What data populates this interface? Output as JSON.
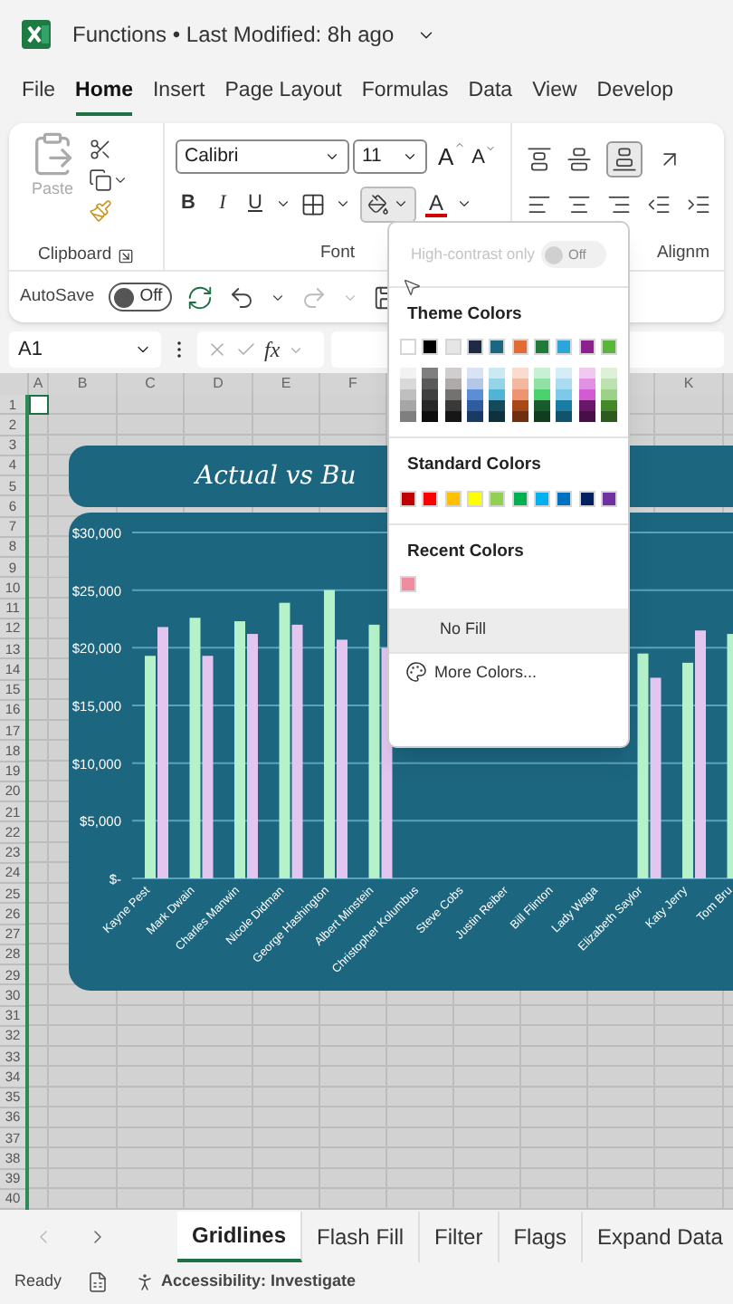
{
  "title_bar": {
    "document": "Functions • Last Modified: 8h ago"
  },
  "menu_tabs": [
    {
      "label": "File",
      "selected": false
    },
    {
      "label": "Home",
      "selected": true
    },
    {
      "label": "Insert",
      "selected": false
    },
    {
      "label": "Page Layout",
      "selected": false
    },
    {
      "label": "Formulas",
      "selected": false
    },
    {
      "label": "Data",
      "selected": false
    },
    {
      "label": "View",
      "selected": false
    },
    {
      "label": "Develop",
      "selected": false
    }
  ],
  "ribbon": {
    "clipboard": {
      "paste": "Paste",
      "label": "Clipboard",
      "paste_disabled": true
    },
    "font": {
      "name": "Calibri",
      "size": "11",
      "grow": "A",
      "shrink": "A",
      "bold": "B",
      "italic": "I",
      "underline": "U",
      "font_color": "A",
      "fill_pressed": true,
      "label": "Font"
    },
    "alignment": {
      "label": "Alignm",
      "bottom_align_pressed": true
    }
  },
  "quick_access": {
    "autosave": "AutoSave",
    "autosave_on": false,
    "toggle_text": "Off",
    "redo_disabled": true
  },
  "formula_bar": {
    "name_box": "A1",
    "fx": "fx"
  },
  "columns": [
    "A",
    "B",
    "C",
    "D",
    "E",
    "F",
    "K"
  ],
  "rows": [
    "1",
    "2",
    "3",
    "4",
    "5",
    "6",
    "7",
    "8",
    "9",
    "10",
    "11",
    "12",
    "13",
    "14",
    "15",
    "16",
    "17",
    "18",
    "19",
    "20",
    "21",
    "22",
    "23",
    "24",
    "25",
    "26",
    "27",
    "28",
    "29",
    "30",
    "31",
    "32",
    "33",
    "34",
    "35",
    "36",
    "37",
    "38",
    "39",
    "40"
  ],
  "chart": {
    "title": "Actual vs Bu",
    "chart_data": {
      "type": "bar",
      "categories": [
        "Kayne Pest",
        "Mark Dwain",
        "Charles Manwin",
        "Nicole Didman",
        "George Hashington",
        "Albert Minstein",
        "Christopher Kolumbus",
        "Steve Cobs",
        "Justin Reiber",
        "Bill Flinton",
        "Lady Waga",
        "Elizabeth Saylor",
        "Katy Jerry",
        "Tom Bru"
      ],
      "series": [
        {
          "color": "#b6f2c9",
          "values": [
            19300,
            22600,
            22300,
            23900,
            25000,
            22000,
            null,
            null,
            null,
            null,
            null,
            19500,
            18700,
            21200
          ]
        },
        {
          "color": "#e2c6f0",
          "values": [
            21800,
            19300,
            21200,
            22000,
            20700,
            20000,
            null,
            null,
            null,
            null,
            null,
            17400,
            21500,
            null
          ]
        }
      ],
      "grid": true,
      "ylim": [
        0,
        30000
      ],
      "yticks": [
        {
          "value": 0,
          "label": "$-"
        },
        {
          "value": 5000,
          "label": "$5,000"
        },
        {
          "value": 10000,
          "label": "$10,000"
        },
        {
          "value": 15000,
          "label": "$15,000"
        },
        {
          "value": 20000,
          "label": "$20,000"
        },
        {
          "value": 25000,
          "label": "$25,000"
        },
        {
          "value": 30000,
          "label": "$30,000"
        }
      ]
    }
  },
  "color_menu": {
    "high_contrast": {
      "label": "High-contrast only",
      "on": false,
      "disabled": true,
      "toggle_text": "Off"
    },
    "theme_title": "Theme Colors",
    "theme_colors": [
      {
        "color": "#ffffff",
        "shades": [
          {
            "color": "#f2f2f2"
          },
          {
            "color": "#d9d9d9"
          },
          {
            "color": "#bfbfbf"
          },
          {
            "color": "#a6a6a6"
          },
          {
            "color": "#7f7f7f"
          }
        ]
      },
      {
        "color": "#000000",
        "shades": [
          {
            "color": "#7f7f7f"
          },
          {
            "color": "#595959"
          },
          {
            "color": "#3f3f3f"
          },
          {
            "color": "#262626"
          },
          {
            "color": "#0d0d0d"
          }
        ]
      },
      {
        "color": "#e7e6e6",
        "shades": [
          {
            "color": "#d0cece"
          },
          {
            "color": "#aeaaaa"
          },
          {
            "color": "#757171"
          },
          {
            "color": "#3a3838"
          },
          {
            "color": "#171616"
          }
        ]
      },
      {
        "color": "#1f2a44",
        "shades": [
          {
            "color": "#dae3f3"
          },
          {
            "color": "#b4c7e7"
          },
          {
            "color": "#5b8ed6"
          },
          {
            "color": "#2e5c9e"
          },
          {
            "color": "#1a3a66"
          }
        ]
      },
      {
        "color": "#1d6680",
        "shades": [
          {
            "color": "#cbe9f3"
          },
          {
            "color": "#97d3e7"
          },
          {
            "color": "#4fb4d6"
          },
          {
            "color": "#15495c"
          },
          {
            "color": "#0e3140"
          }
        ]
      },
      {
        "color": "#e06c32",
        "shades": [
          {
            "color": "#f9dccf"
          },
          {
            "color": "#f3b9a0"
          },
          {
            "color": "#ec9570"
          },
          {
            "color": "#a84717"
          },
          {
            "color": "#70300f"
          }
        ]
      },
      {
        "color": "#217a3a",
        "shades": [
          {
            "color": "#c8f0d2"
          },
          {
            "color": "#91e1a5"
          },
          {
            "color": "#4cd26d"
          },
          {
            "color": "#185c2b"
          },
          {
            "color": "#103d1d"
          }
        ]
      },
      {
        "color": "#2aa6d8",
        "shades": [
          {
            "color": "#d4edf7"
          },
          {
            "color": "#aadbf0"
          },
          {
            "color": "#7fc9e8"
          },
          {
            "color": "#1a7ca2"
          },
          {
            "color": "#11536c"
          }
        ]
      },
      {
        "color": "#8e1f8e",
        "shades": [
          {
            "color": "#f0c8f0"
          },
          {
            "color": "#e191e1"
          },
          {
            "color": "#d25ad2"
          },
          {
            "color": "#6a176a"
          },
          {
            "color": "#470f47"
          }
        ]
      },
      {
        "color": "#5bb53a",
        "shades": [
          {
            "color": "#def0d7"
          },
          {
            "color": "#bde1b0"
          },
          {
            "color": "#9cd288"
          },
          {
            "color": "#44882b"
          },
          {
            "color": "#2d5a1d"
          }
        ]
      }
    ],
    "standard_title": "Standard Colors",
    "standard_colors": [
      {
        "color": "#c00000"
      },
      {
        "color": "#ff0000"
      },
      {
        "color": "#ffc000"
      },
      {
        "color": "#ffff00"
      },
      {
        "color": "#92d050"
      },
      {
        "color": "#00b050"
      },
      {
        "color": "#00b0f0"
      },
      {
        "color": "#0070c0"
      },
      {
        "color": "#002060"
      },
      {
        "color": "#7030a0"
      }
    ],
    "recent_title": "Recent Colors",
    "recent_colors": [
      {
        "color": "#f08ca0"
      }
    ],
    "no_fill": {
      "label": "No Fill",
      "hovered": true
    },
    "more_colors": "More Colors..."
  },
  "sheet_tabs": [
    {
      "label": "Gridlines",
      "selected": true
    },
    {
      "label": "Flash Fill",
      "selected": false
    },
    {
      "label": "Filter",
      "selected": false
    },
    {
      "label": "Flags",
      "selected": false
    },
    {
      "label": "Expand Data",
      "selected": false
    }
  ],
  "status_bar": {
    "ready": "Ready",
    "accessibility": "Accessibility: Investigate"
  }
}
